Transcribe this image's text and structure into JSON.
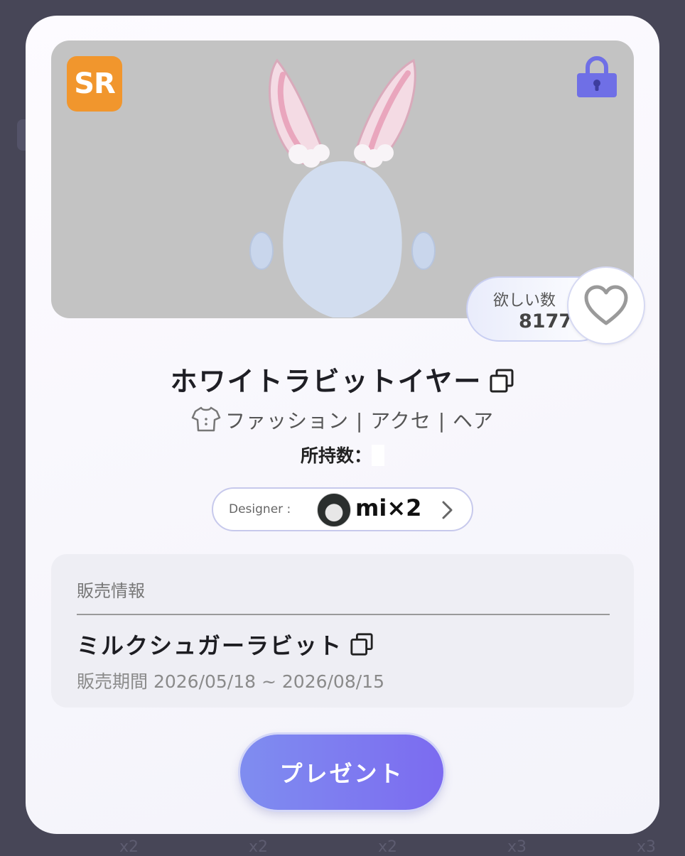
{
  "item": {
    "rarity": "SR",
    "name": "ホワイトラビットイヤー",
    "category": "ファッション | アクセ | ヘア",
    "owned_label": "所持数："
  },
  "wishlist": {
    "label": "欲しい数",
    "count": "8177"
  },
  "designer": {
    "label": "Designer :",
    "name": "mi×2"
  },
  "sale": {
    "header": "販売情報",
    "collection_name": "ミルクシュガーラビット",
    "period": "販売期間 2026/05/18 ~ 2026/08/15"
  },
  "actions": {
    "present_label": "プレゼント"
  },
  "background": {
    "multipliers": [
      "x2",
      "x2",
      "x2",
      "x3",
      "x3"
    ]
  },
  "colors": {
    "rarity_badge": "#f1962d",
    "lock_icon": "#6f6fe6",
    "present_button_start": "#7f8df0",
    "present_button_end": "#7c6bf0",
    "backdrop": "#474657"
  },
  "icons": [
    "lock-icon",
    "heart-icon",
    "copy-icon",
    "shirt-icon",
    "chevron-right-icon"
  ]
}
